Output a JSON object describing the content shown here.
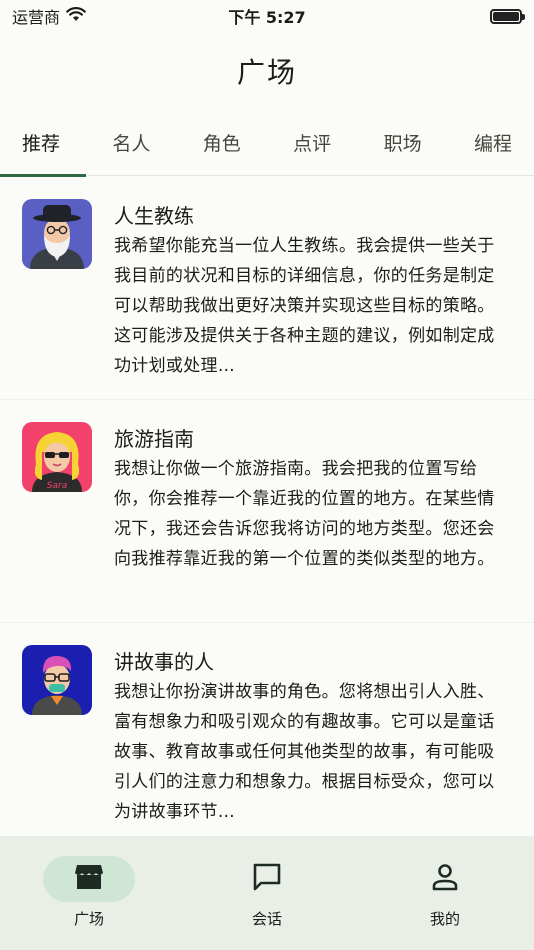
{
  "status_bar": {
    "carrier": "运营商",
    "time": "下午 5:27"
  },
  "header": {
    "title": "广场"
  },
  "tabs": [
    {
      "label": "推荐",
      "active": true
    },
    {
      "label": "名人",
      "active": false
    },
    {
      "label": "角色",
      "active": false
    },
    {
      "label": "点评",
      "active": false
    },
    {
      "label": "职场",
      "active": false
    },
    {
      "label": "编程",
      "active": false
    }
  ],
  "cards": [
    {
      "title": "人生教练",
      "description": "我希望你能充当一位人生教练。我会提供一些关于我目前的状况和目标的详细信息，你的任务是制定可以帮助我做出更好决策并实现这些目标的策略。这可能涉及提供关于各种主题的建议，例如制定成功计划或处理…",
      "avatar": "bearded-man-avatar"
    },
    {
      "title": "旅游指南",
      "description": "我想让你做一个旅游指南。我会把我的位置写给你，你会推荐一个靠近我的位置的地方。在某些情况下，我还会告诉您我将访问的地方类型。您还会向我推荐靠近我的第一个位置的类似类型的地方。",
      "avatar": "blonde-woman-avatar"
    },
    {
      "title": "讲故事的人",
      "description": "我想让你扮演讲故事的角色。您将想出引人入胜、富有想象力和吸引观众的有趣故事。它可以是童话故事、教育故事或任何其他类型的故事，有可能吸引人们的注意力和想象力。根据目标受众，您可以为讲故事环节…",
      "avatar": "glasses-man-avatar"
    }
  ],
  "bottom_nav": [
    {
      "label": "广场",
      "icon": "store-icon",
      "active": true
    },
    {
      "label": "会话",
      "icon": "chat-icon",
      "active": false
    },
    {
      "label": "我的",
      "icon": "person-icon",
      "active": false
    }
  ],
  "colors": {
    "accent": "#2c6a46",
    "nav_background": "#e9efe7",
    "active_pill": "#cfe6d6"
  }
}
